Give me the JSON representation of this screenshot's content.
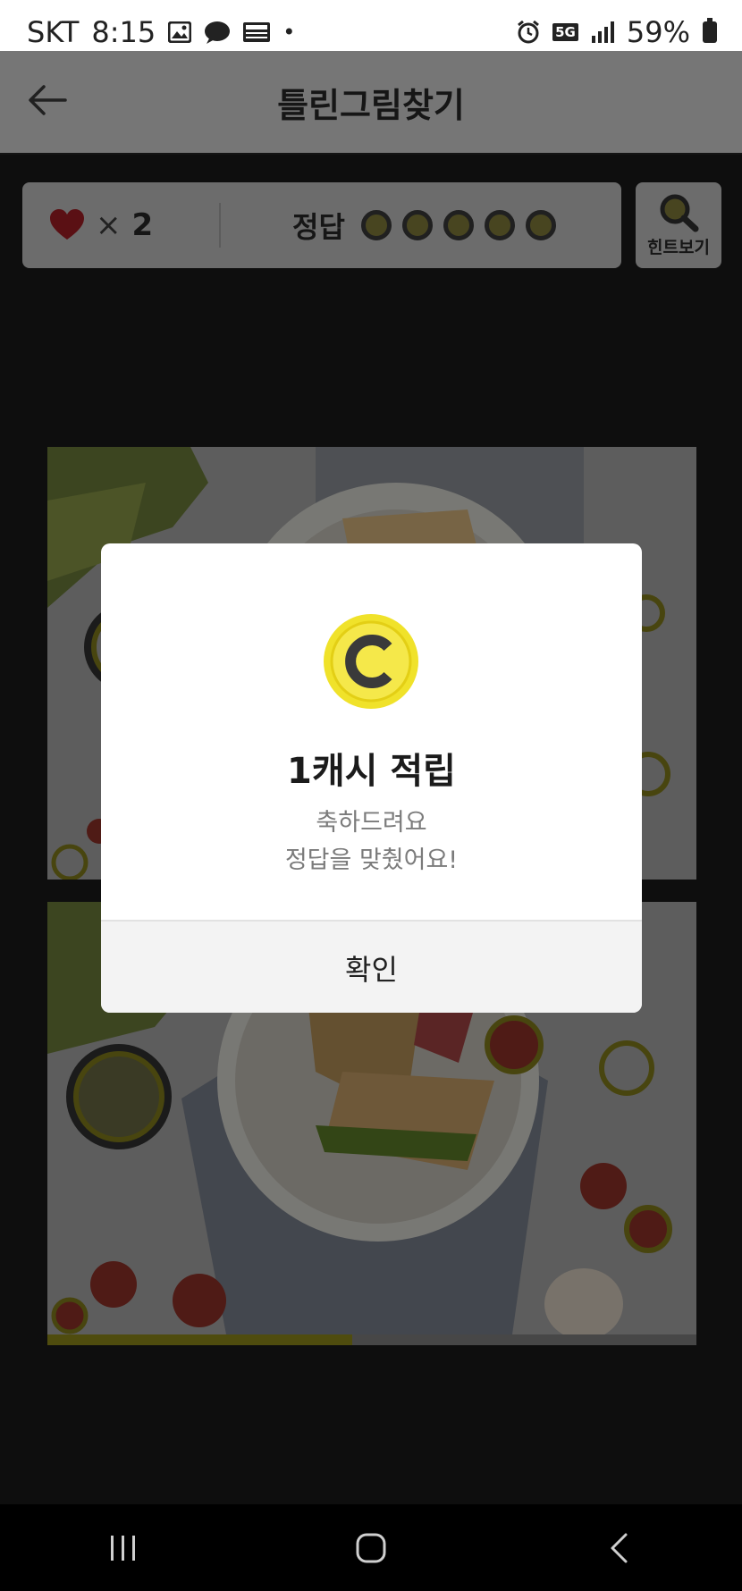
{
  "status_bar": {
    "carrier": "SKT",
    "time": "8:15",
    "network": "5G",
    "battery": "59%"
  },
  "header": {
    "title": "틀린그림찾기"
  },
  "game_status": {
    "lives_symbol": "×",
    "lives_count": "2",
    "answer_label": "정답",
    "answers_found": 0,
    "answers_total": 5,
    "hint_label": "힌트보기"
  },
  "progress": {
    "fraction": 0.47
  },
  "modal": {
    "coin_icon": "cash-coin-icon",
    "title": "1캐시 적립",
    "message_line1": "축하드려요",
    "message_line2": "정답을 맞췄어요!",
    "confirm_label": "확인"
  },
  "colors": {
    "accent_yellow": "#F5E21E",
    "heart_red": "#C9262E"
  },
  "icons": {
    "back": "arrow-left-icon",
    "heart": "heart-icon",
    "hint": "magnifier-icon",
    "nav_recent": "recent-apps-icon",
    "nav_home": "home-icon",
    "nav_back": "chevron-left-icon"
  }
}
